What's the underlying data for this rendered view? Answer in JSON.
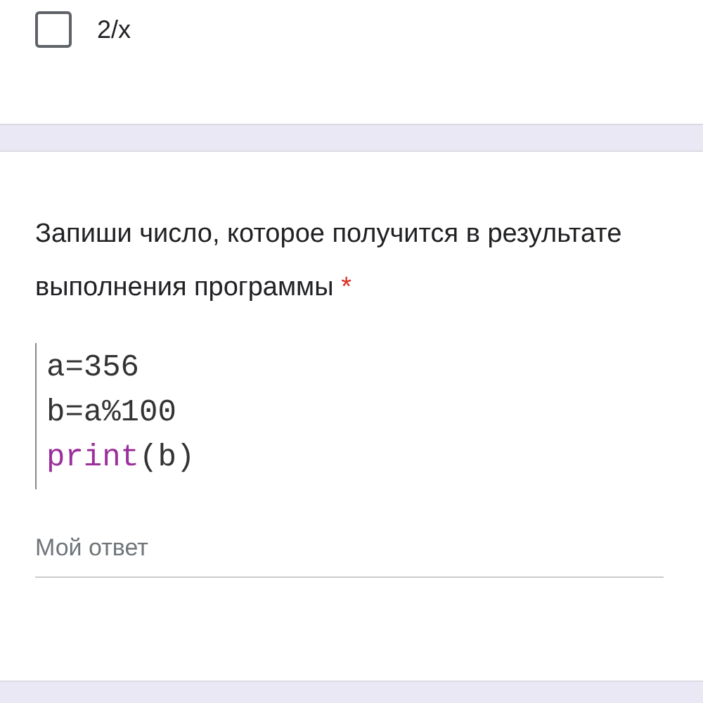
{
  "options": [
    {
      "label": "2/x",
      "checked": false
    }
  ],
  "question": {
    "title": "Запиши число, которое получится в результате выполнения программы",
    "required_mark": "*",
    "code_lines": [
      [
        {
          "text": "a=356",
          "kind": "plain"
        }
      ],
      [
        {
          "text": "b=a%100",
          "kind": "plain"
        }
      ],
      [
        {
          "text": "print",
          "kind": "keyword"
        },
        {
          "text": "(b)",
          "kind": "plain"
        }
      ]
    ],
    "answer": {
      "placeholder": "Мой ответ"
    }
  }
}
